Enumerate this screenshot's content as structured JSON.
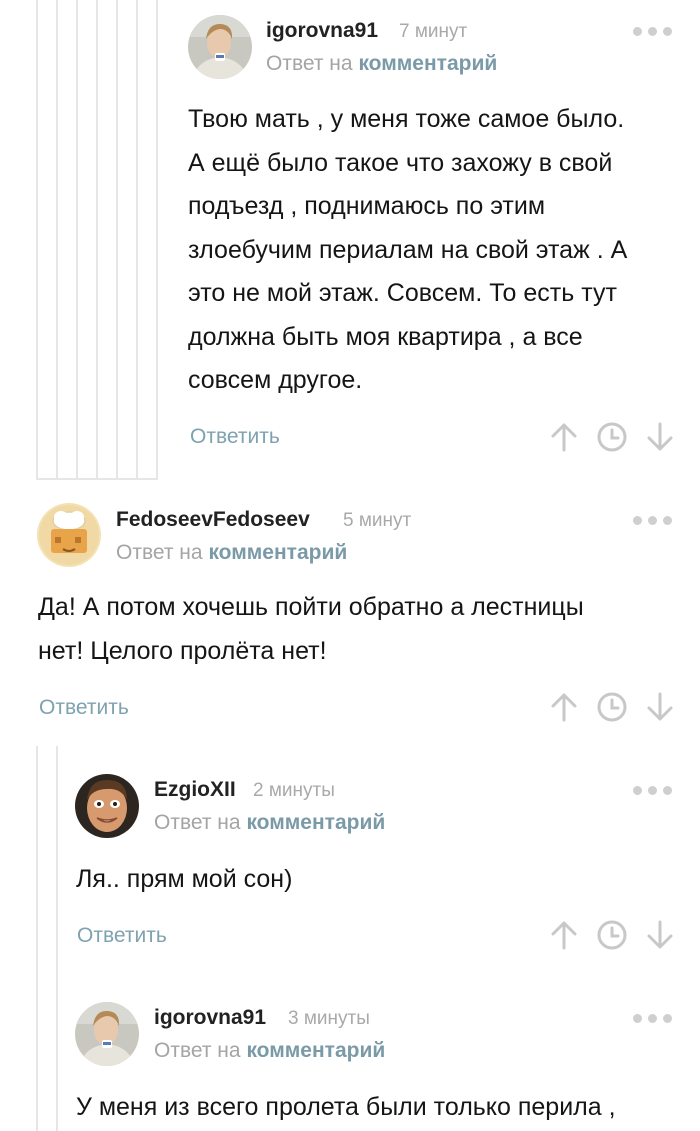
{
  "reply_to_prefix": "Ответ на",
  "reply_to_link": "комментарий",
  "reply_label": "Ответить",
  "icons": {
    "more": "more-dots-icon",
    "upvote": "arrow-up-icon",
    "save": "clock-icon",
    "downvote": "arrow-down-icon"
  },
  "colors": {
    "accent": "#7fa2b0",
    "muted": "#a9a9a9",
    "thread_line": "#e6e6e6"
  },
  "comments": [
    {
      "username": "igorovna91",
      "time": "7 минут",
      "text": "Твою мать , у меня тоже самое было.\nА ещё было такое что захожу в свой\nподъезд , поднимаюсь по этим\nзлоебучим периалам на свой этаж . А\nэто не мой этаж. Совсем. То есть тут\nдолжна быть моя квартира , а все\nсовсем другое."
    },
    {
      "username": "FedoseevFedoseev",
      "time": "5 минут",
      "text": "Да! А потом хочешь пойти обратно а лестницы\nнет! Целого пролёта нет!"
    },
    {
      "username": "EzgioXII",
      "time": "2 минуты",
      "text": "Ля.. прям мой сон)"
    },
    {
      "username": "igorovna91",
      "time": "3 минуты",
      "text": "У меня из всего пролета были только перила ,"
    }
  ]
}
